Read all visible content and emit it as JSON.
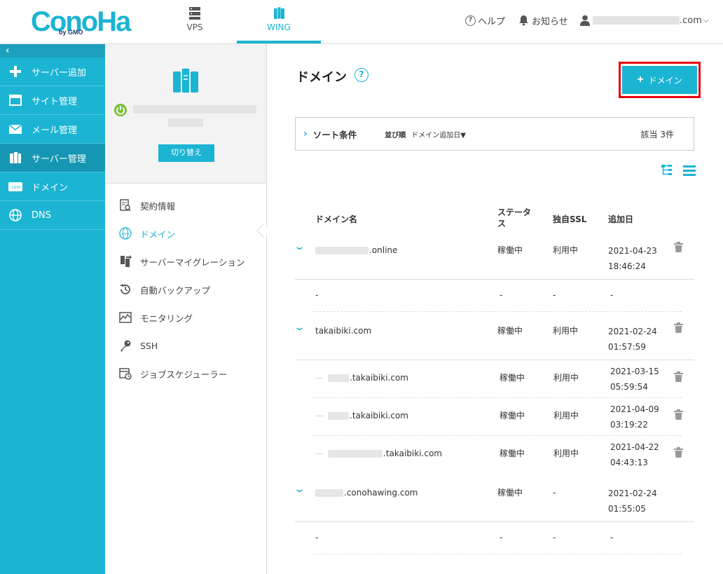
{
  "header": {
    "logo_text": "ConoHa",
    "logo_sub": "by GMO",
    "nav": [
      {
        "label": "VPS",
        "icon": "server-rack-icon"
      },
      {
        "label": "WING",
        "icon": "wing-server-icon"
      }
    ],
    "help_label": "ヘルプ",
    "notice_label": "お知らせ",
    "account_suffix": ".com"
  },
  "sidebar": {
    "collapse_glyph": "‹",
    "items": [
      {
        "label": "サーバー追加",
        "icon": "plus-icon"
      },
      {
        "label": "サイト管理",
        "icon": "window-icon"
      },
      {
        "label": "メール管理",
        "icon": "mail-icon"
      },
      {
        "label": "サーバー管理",
        "icon": "server-icon"
      },
      {
        "label": "ドメイン",
        "icon": "domain-com-icon"
      },
      {
        "label": "DNS",
        "icon": "globe-icon"
      }
    ]
  },
  "panel": {
    "switch_label": "切り替え",
    "menu": [
      {
        "label": "契約情報",
        "icon": "contract-icon"
      },
      {
        "label": "ドメイン",
        "icon": "www-globe-icon"
      },
      {
        "label": "サーバーマイグレーション",
        "icon": "migration-icon"
      },
      {
        "label": "自動バックアップ",
        "icon": "backup-icon"
      },
      {
        "label": "モニタリング",
        "icon": "monitoring-icon"
      },
      {
        "label": "SSH",
        "icon": "key-icon"
      },
      {
        "label": "ジョブスケジューラー",
        "icon": "scheduler-icon"
      }
    ]
  },
  "main": {
    "title": "ドメイン",
    "help_glyph": "?",
    "add_button": "ドメイン",
    "add_plus": "+",
    "sort": {
      "chevron": "›",
      "title": "ソート条件",
      "key_label": "並び順",
      "key_value": "ドメイン追加日▼",
      "count": "該当 3件"
    },
    "columns": {
      "name": "ドメイン名",
      "status": "ステータス",
      "ssl": "独自SSL",
      "date": "追加日"
    },
    "rows": [
      {
        "name": ".online",
        "status": "稼働中",
        "ssl": "利用中",
        "date1": "2021-04-23",
        "date2": "18:46:24"
      },
      {
        "name": "-",
        "status": "-",
        "ssl": "-",
        "date1": "-"
      },
      {
        "name": "takaibiki.com",
        "status": "稼働中",
        "ssl": "利用中",
        "date1": "2021-02-24",
        "date2": "01:57:59"
      },
      {
        "name": ".takaibiki.com",
        "status": "稼働中",
        "ssl": "利用中",
        "date1": "2021-03-15",
        "date2": "05:59:54"
      },
      {
        "name": ".takaibiki.com",
        "status": "稼働中",
        "ssl": "利用中",
        "date1": "2021-04-09",
        "date2": "03:19:22"
      },
      {
        "name": ".takaibiki.com",
        "status": "稼働中",
        "ssl": "利用中",
        "date1": "2021-04-22",
        "date2": "04:43:13"
      },
      {
        "name": ".conohawing.com",
        "status": "稼働中",
        "ssl": "-",
        "date1": "2021-02-24",
        "date2": "01:55:05"
      },
      {
        "name": "-",
        "status": "-",
        "ssl": "-",
        "date1": "-"
      }
    ],
    "sub_prefix": "—",
    "chevron": "⌄"
  },
  "colors": {
    "brand": "#1bb4d3",
    "sidebar_active": "#1597b3",
    "highlight": "#e60012",
    "power": "#7cbf3b"
  }
}
